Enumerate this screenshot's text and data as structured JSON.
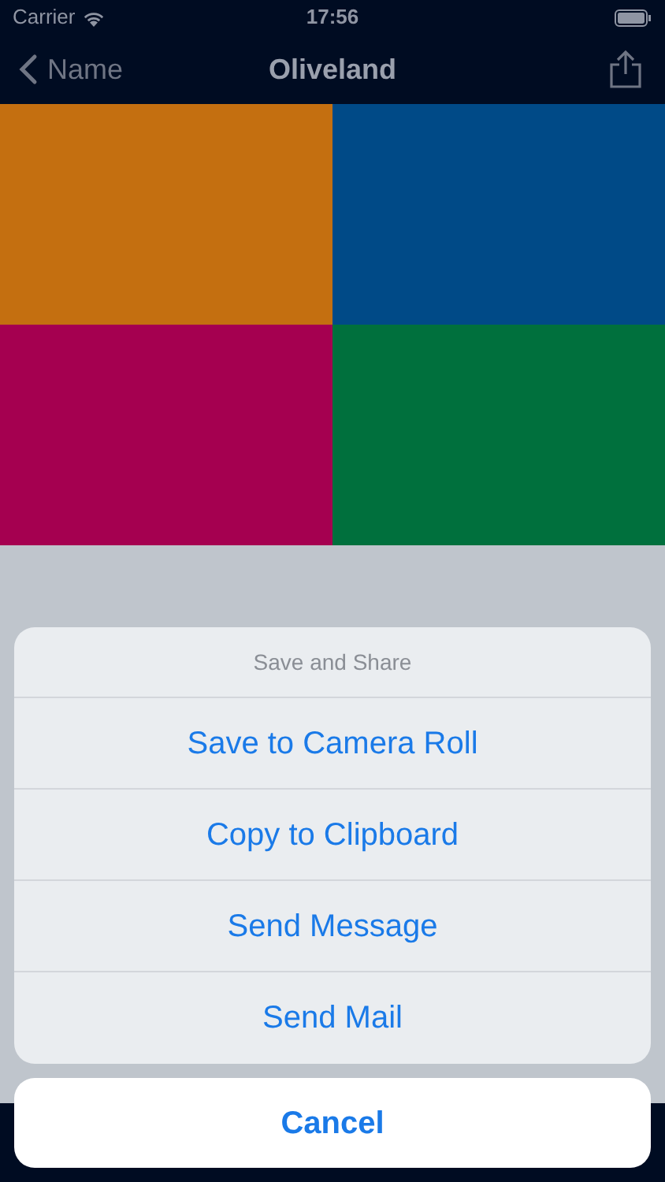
{
  "status_bar": {
    "carrier": "Carrier",
    "time": "17:56"
  },
  "nav_bar": {
    "back": "Name",
    "title": "Oliveland"
  },
  "flag": {
    "quadrants": [
      {
        "color": "#c46f10"
      },
      {
        "color": "#004a87"
      },
      {
        "color": "#a50050"
      },
      {
        "color": "#00703d"
      }
    ]
  },
  "action_sheet": {
    "title": "Save and Share",
    "actions": [
      "Save to Camera Roll",
      "Copy to Clipboard",
      "Send Message",
      "Send Mail"
    ],
    "cancel": "Cancel"
  }
}
